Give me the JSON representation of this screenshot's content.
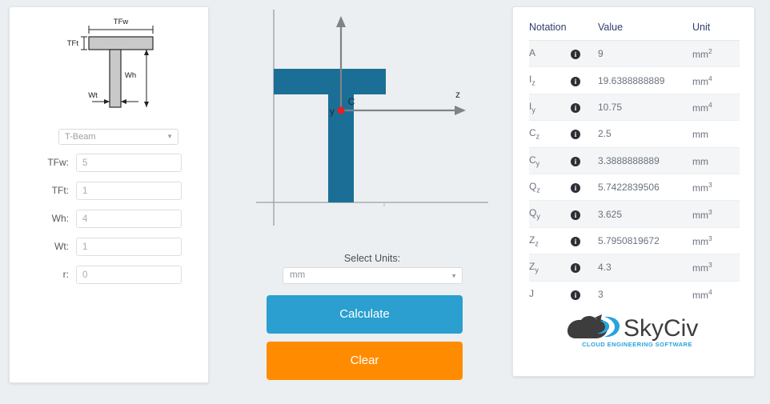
{
  "app": {
    "background_color": "#eceff1",
    "accent_blue": "#2a9fd0",
    "accent_orange": "#ff8c00",
    "section_fill": "#1b6e96"
  },
  "left_panel": {
    "diagram": {
      "name": "t-beam-dimension-diagram",
      "labels": {
        "top_flange_width": "TFw",
        "top_flange_thickness": "TFt",
        "web_height": "Wh",
        "web_thickness": "Wt"
      }
    },
    "shape_select": {
      "value": "T-Beam",
      "caret": "chevron-down-icon"
    },
    "fields": [
      {
        "label": "TFw:",
        "value": "5",
        "name": "tfw-field"
      },
      {
        "label": "TFt:",
        "value": "1",
        "name": "tft-field"
      },
      {
        "label": "Wh:",
        "value": "4",
        "name": "wh-field"
      },
      {
        "label": "Wt:",
        "value": "1",
        "name": "wt-field"
      },
      {
        "label": "r:",
        "value": "0",
        "name": "r-field"
      }
    ]
  },
  "center_panel": {
    "plot": {
      "name": "section-cross-section-plot",
      "axis_z_label": "z",
      "axis_y_label": "y",
      "centroid_label": "C",
      "centroid_color": "#ee1b24"
    },
    "units_label": "Select Units:",
    "units_select": {
      "value": "mm",
      "caret": "chevron-down-icon"
    },
    "calculate_button": "Calculate",
    "clear_button": "Clear"
  },
  "right_panel": {
    "headers": {
      "notation": "Notation",
      "value": "Value",
      "unit": "Unit"
    },
    "info_icon": "info-icon",
    "rows": [
      {
        "notation": "A",
        "sub": "",
        "value": "9",
        "unit": "mm",
        "exp": "2"
      },
      {
        "notation": "I",
        "sub": "z",
        "value": "19.6388888889",
        "unit": "mm",
        "exp": "4"
      },
      {
        "notation": "I",
        "sub": "y",
        "value": "10.75",
        "unit": "mm",
        "exp": "4"
      },
      {
        "notation": "C",
        "sub": "z",
        "value": "2.5",
        "unit": "mm",
        "exp": ""
      },
      {
        "notation": "C",
        "sub": "y",
        "value": "3.3888888889",
        "unit": "mm",
        "exp": ""
      },
      {
        "notation": "Q",
        "sub": "z",
        "value": "5.7422839506",
        "unit": "mm",
        "exp": "3"
      },
      {
        "notation": "Q",
        "sub": "y",
        "value": "3.625",
        "unit": "mm",
        "exp": "3"
      },
      {
        "notation": "Z",
        "sub": "z",
        "value": "5.7950819672",
        "unit": "mm",
        "exp": "3"
      },
      {
        "notation": "Z",
        "sub": "y",
        "value": "4.3",
        "unit": "mm",
        "exp": "3"
      },
      {
        "notation": "J",
        "sub": "",
        "value": "3",
        "unit": "mm",
        "exp": "4"
      }
    ],
    "logo": {
      "name": "skyciv-logo",
      "text_sky": "Sky",
      "text_civ": "Civ",
      "tagline": "CLOUD ENGINEERING SOFTWARE",
      "color_sky": "#3d3d3d",
      "color_swoosh": "#29a3dc",
      "color_tagline": "#29a3dc"
    }
  }
}
